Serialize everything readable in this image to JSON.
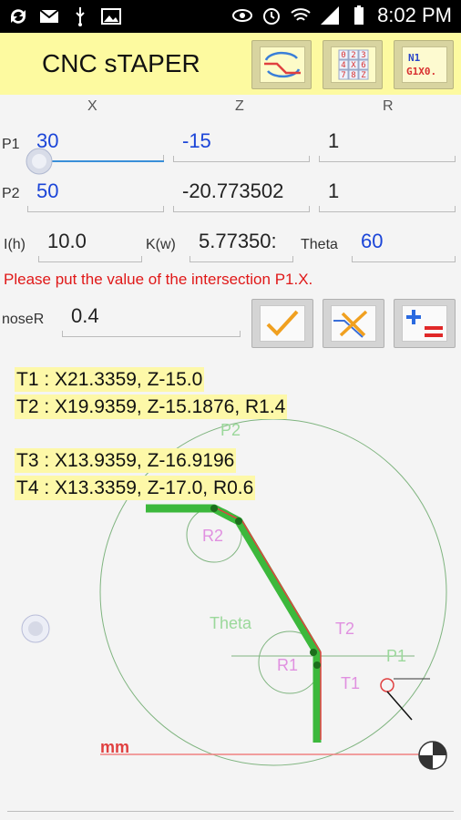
{
  "status_bar": {
    "time": "8:02 PM",
    "icons": [
      "sync-icon",
      "mail-icon",
      "usb-icon",
      "image-icon",
      "eye-icon",
      "alarm-icon",
      "wifi-icon",
      "signal-icon",
      "battery-icon"
    ]
  },
  "app": {
    "title": "CNC sTAPER",
    "toolbar": [
      "rotate-taper-icon",
      "number-grid-icon",
      "gcode-icon"
    ],
    "gcode_icon_text": [
      "N1",
      "G1X0."
    ],
    "grid_icon_digits": [
      "0",
      "2",
      "3",
      "4",
      "X",
      "6",
      "7",
      "8",
      "Z"
    ]
  },
  "columns": {
    "x": "X",
    "z": "Z",
    "r": "R"
  },
  "p1": {
    "label": "P1",
    "x": "30",
    "z": "-15",
    "r": "1"
  },
  "p2": {
    "label": "P2",
    "x": "50",
    "z": "-20.773502",
    "r": "1"
  },
  "params": {
    "i_label": "I(h)",
    "i_value": "10.0",
    "k_label": "K(w)",
    "k_value": "5.77350:",
    "theta_label": "Theta",
    "theta_value": "60"
  },
  "error_message": "Please put the value of the intersection P1.X.",
  "nose": {
    "label": "noseR",
    "value": "0.4"
  },
  "results": {
    "t1": "T1 : X21.3359, Z-15.0",
    "t2": "T2 : X19.9359, Z-15.1876, R1.4",
    "t3": "T3 : X13.9359, Z-16.9196",
    "t4": "T4 : X13.3359, Z-17.0, R0.6"
  },
  "diagram": {
    "labels": {
      "p1": "P1",
      "p2": "P2",
      "r1": "R1",
      "r2": "R2",
      "t1": "T1",
      "t2": "T2",
      "theta": "Theta",
      "unit": "mm"
    },
    "colors": {
      "path": "#3cb83c",
      "red_line": "#e04040",
      "circle": "#6aa86a",
      "pink": "#e090e0",
      "label_green": "#9bd89b"
    }
  }
}
